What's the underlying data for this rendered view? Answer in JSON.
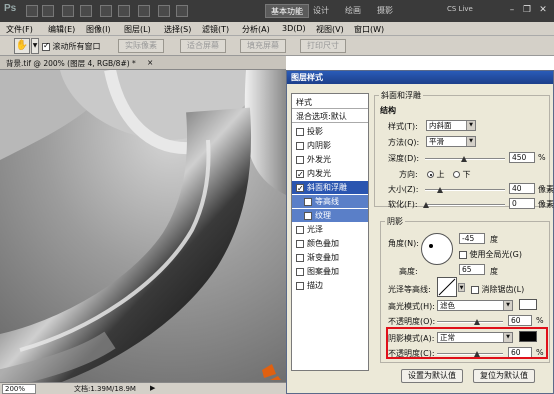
{
  "appbar": {
    "logo": "Ps",
    "workspaces": [
      "基本功能",
      "设计",
      "绘画",
      "摄影"
    ],
    "cs_live": "CS Live"
  },
  "menubar": {
    "items": [
      "文件(F)",
      "编辑(E)",
      "图像(I)",
      "图层(L)",
      "选择(S)",
      "滤镜(T)",
      "分析(A)",
      "3D(D)",
      "视图(V)",
      "窗口(W)"
    ]
  },
  "optbar": {
    "scroll_all": "滚动所有窗口",
    "buttons": [
      "实际像素",
      "适合屏幕",
      "填充屏幕",
      "打印尺寸"
    ]
  },
  "doctab": {
    "title": "背景.tif @ 200% (图层 4, RGB/8#) *",
    "close": "×"
  },
  "statusbar": {
    "zoom": "200%",
    "doc": "文档:1.39M/18.9M",
    "arrow": "▶"
  },
  "colors": {
    "highlight": "#e0101a",
    "selected": "#2a55b0",
    "shadow_swatch": "#000000",
    "highlight_swatch": "#ffffff"
  },
  "dialog": {
    "title": "图层样式",
    "styles": [
      {
        "label": "样式",
        "type": "header"
      },
      {
        "label": "混合选项:默认",
        "type": "header"
      },
      {
        "label": "投影",
        "checked": false
      },
      {
        "label": "内阴影",
        "checked": false
      },
      {
        "label": "外发光",
        "checked": false
      },
      {
        "label": "内发光",
        "checked": true
      },
      {
        "label": "斜面和浮雕",
        "checked": true,
        "selected": true
      },
      {
        "label": "等高线",
        "checked": false,
        "sub": true
      },
      {
        "label": "纹理",
        "checked": false,
        "sub": true
      },
      {
        "label": "光泽",
        "checked": false
      },
      {
        "label": "颜色叠加",
        "checked": false
      },
      {
        "label": "渐变叠加",
        "checked": false
      },
      {
        "label": "图案叠加",
        "checked": false
      },
      {
        "label": "描边",
        "checked": false
      }
    ],
    "bevel": {
      "group": "斜面和浮雕",
      "structure": "结构",
      "style_label": "样式(T):",
      "style_value": "内斜面",
      "technique_label": "方法(Q):",
      "technique_value": "平滑",
      "depth_label": "深度(D):",
      "depth_value": "450",
      "depth_unit": "%",
      "direction_label": "方向:",
      "dir_up": "上",
      "dir_down": "下",
      "size_label": "大小(Z):",
      "size_value": "40",
      "size_unit": "像素",
      "soften_label": "软化(F):",
      "soften_value": "0",
      "soften_unit": "像素"
    },
    "shading": {
      "group": "阴影",
      "angle_label": "角度(N):",
      "angle_value": "-45",
      "angle_unit": "度",
      "global_light": "使用全局光(G)",
      "altitude_label": "高度:",
      "altitude_value": "65",
      "altitude_unit": "度",
      "gloss_label": "光泽等高线:",
      "anti_alias": "消除锯齿(L)",
      "highlight_mode_label": "高光模式(H):",
      "highlight_mode_value": "滤色",
      "highlight_opacity_label": "不透明度(O):",
      "highlight_opacity_value": "60",
      "highlight_opacity_unit": "%",
      "shadow_mode_label": "阴影模式(A):",
      "shadow_mode_value": "正常",
      "shadow_opacity_label": "不透明度(C):",
      "shadow_opacity_value": "60",
      "shadow_opacity_unit": "%"
    },
    "buttons": {
      "make_default": "设置为默认值",
      "reset_default": "复位为默认值"
    }
  }
}
